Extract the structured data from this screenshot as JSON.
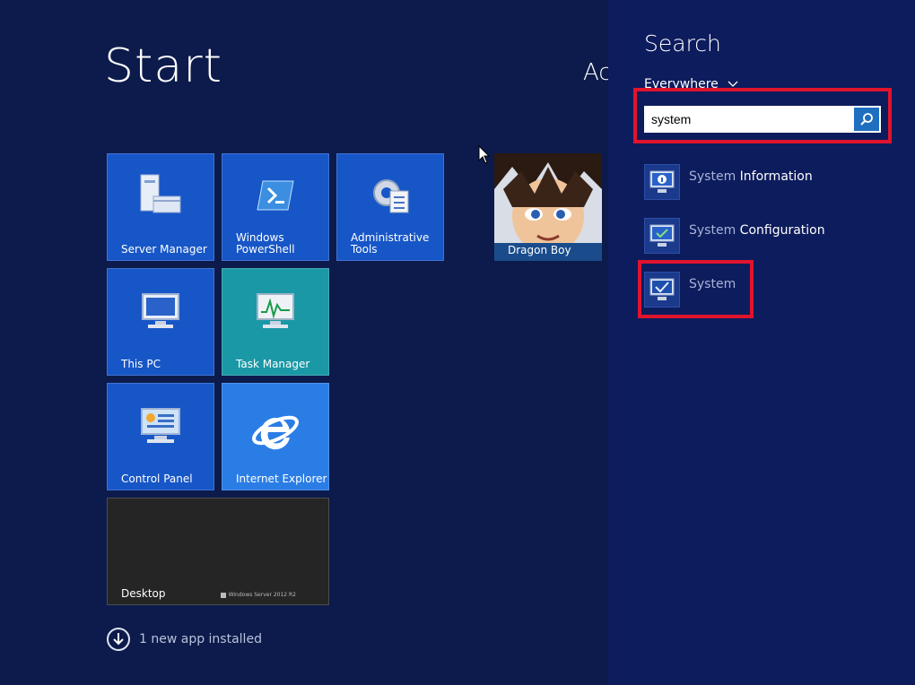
{
  "start": {
    "title": "Start",
    "user_partial": "Ac",
    "tiles": {
      "server_manager": "Server Manager",
      "powershell": "Windows PowerShell",
      "admin_tools": "Administrative Tools",
      "this_pc": "This PC",
      "task_manager": "Task Manager",
      "control_panel": "Control Panel",
      "internet_explorer": "Internet Explorer",
      "desktop": "Desktop",
      "desktop_watermark": "Windows Server 2012 R2",
      "avatar": "Dragon Boy"
    },
    "notification": "1 new app installed"
  },
  "search": {
    "title": "Search",
    "scope": "Everywhere",
    "query": "system",
    "results": [
      {
        "prefix": "System",
        "rest": " Information",
        "icon": "system-information-icon"
      },
      {
        "prefix": "System",
        "rest": " Configuration",
        "icon": "system-configuration-icon"
      },
      {
        "prefix": "System",
        "rest": "",
        "icon": "system-icon"
      }
    ]
  },
  "colors": {
    "start_bg": "#0c1b4b",
    "search_bg": "#0d1c5c",
    "tile_blue": "#1756c7",
    "tile_teal": "#1a98a6",
    "highlight_red": "#e0142c"
  }
}
